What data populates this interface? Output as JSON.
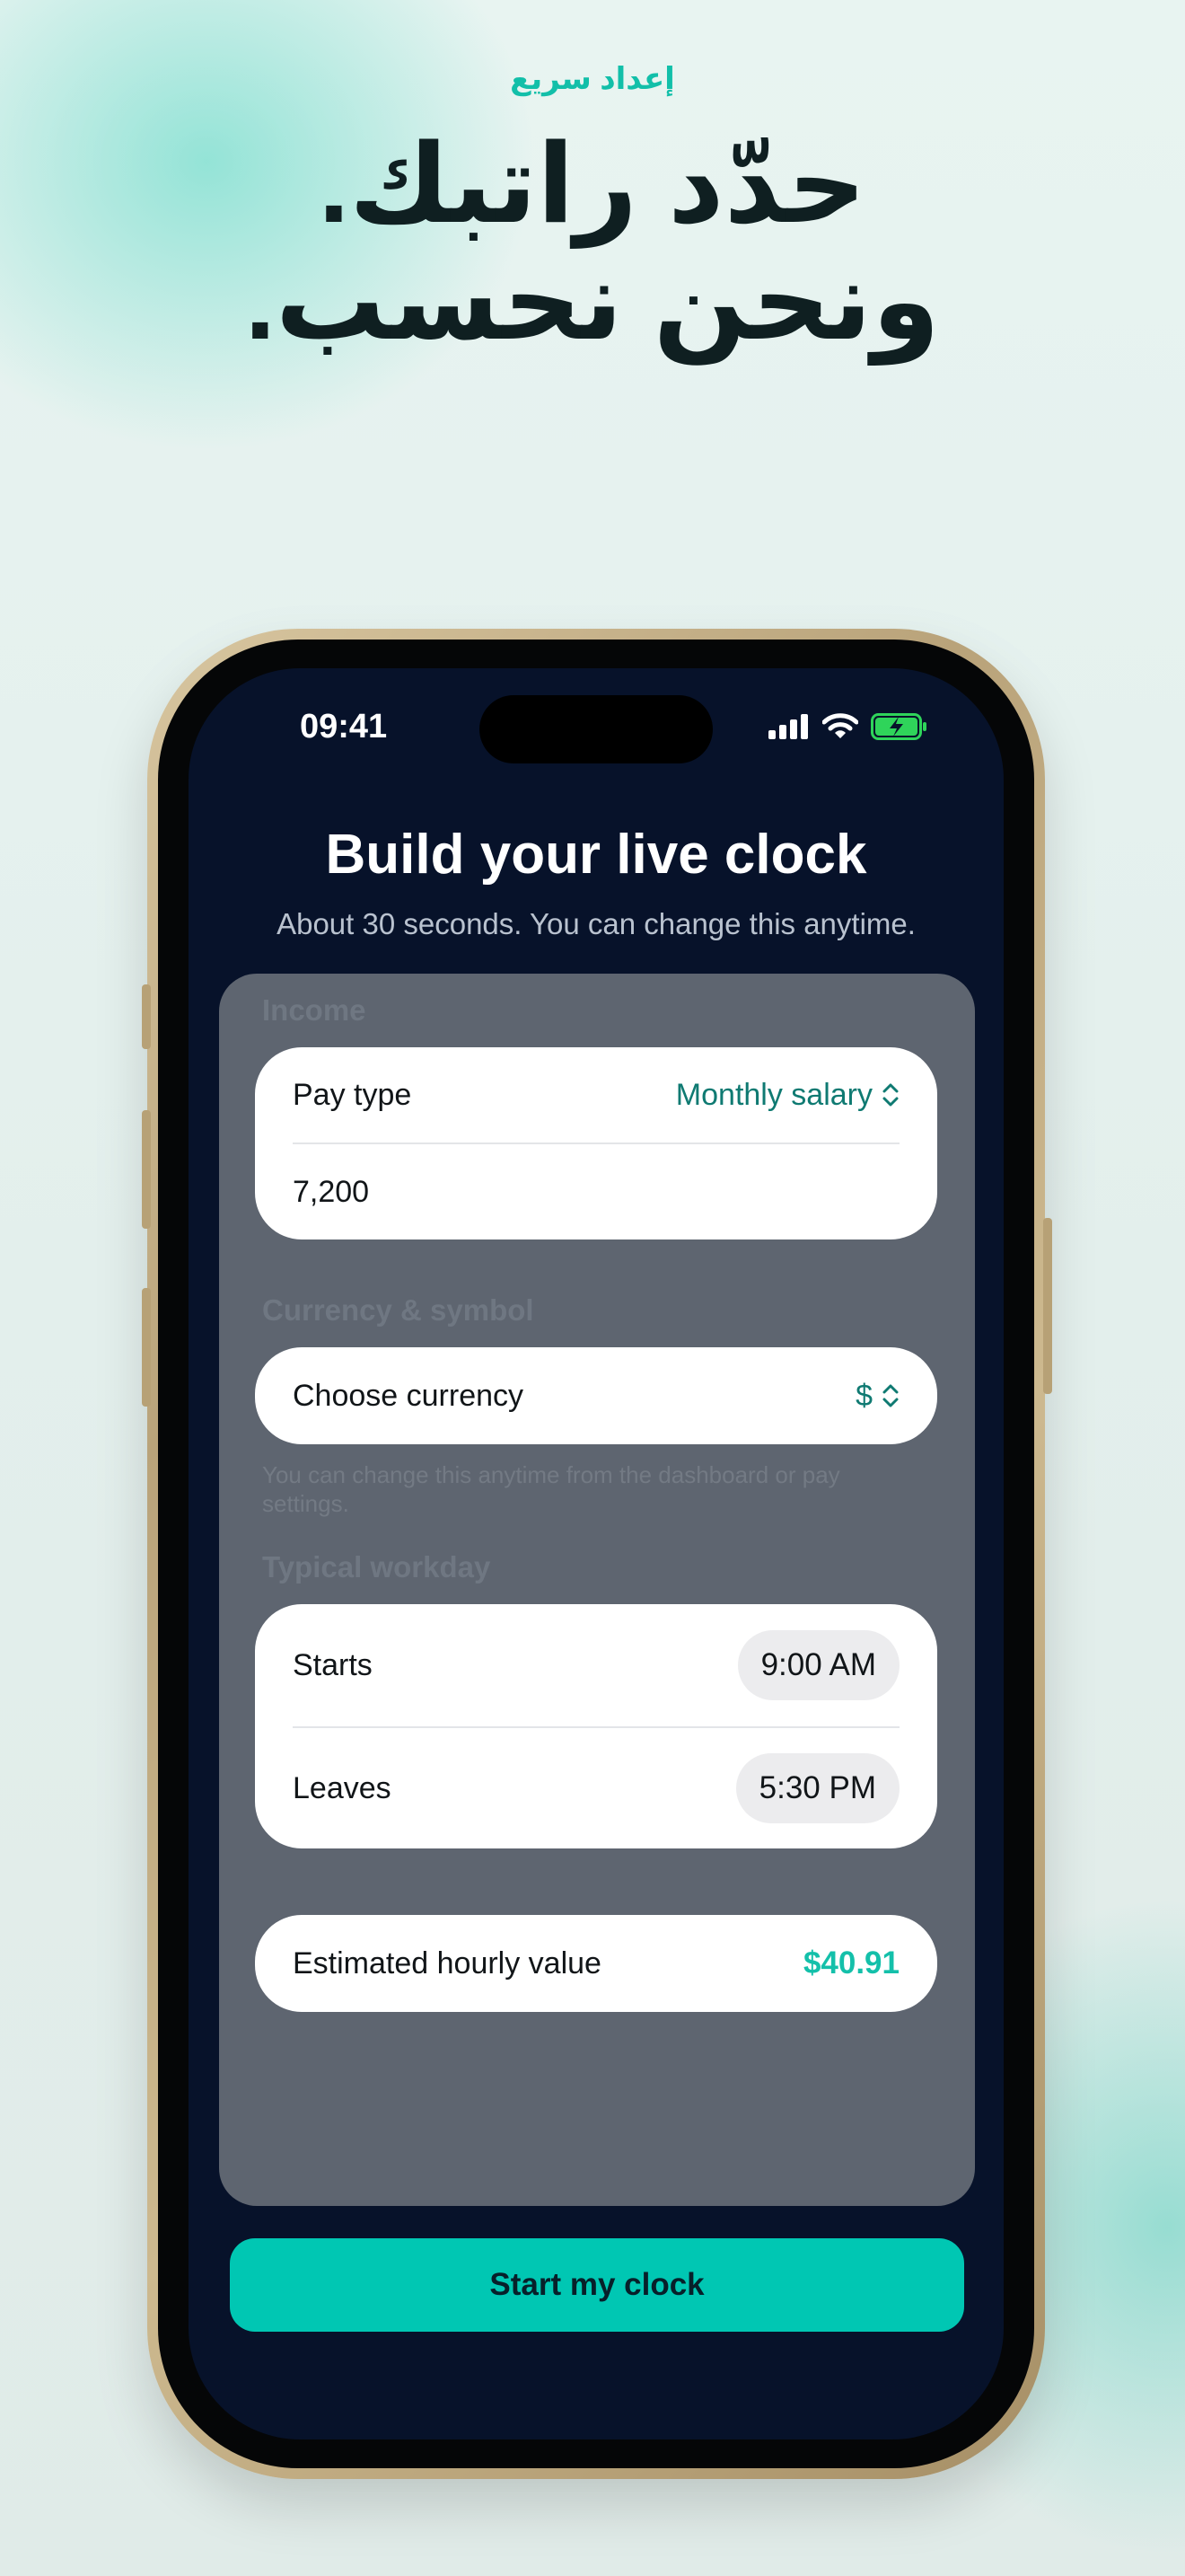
{
  "hero": {
    "eyebrow": "إعداد سريع",
    "headline_line1": "حدّد راتبك.",
    "headline_line2": "ونحن نحسب."
  },
  "status_bar": {
    "time": "09:41",
    "icons": [
      "signal-icon",
      "wifi-icon",
      "battery-charging-icon"
    ]
  },
  "screen": {
    "title": "Build your live clock",
    "subtitle": "About 30 seconds. You can change this anytime."
  },
  "income": {
    "section_label": "Income",
    "pay_type_label": "Pay type",
    "pay_type_value": "Monthly salary",
    "amount_value": "7,200"
  },
  "currency": {
    "section_label": "Currency & symbol",
    "choose_label": "Choose currency",
    "symbol": "$",
    "help": "You can change this anytime from the dashboard or pay settings."
  },
  "workday": {
    "section_label": "Typical workday",
    "starts_label": "Starts",
    "starts_value": "9:00 AM",
    "leaves_label": "Leaves",
    "leaves_value": "5:30 PM"
  },
  "estimate": {
    "label": "Estimated hourly value",
    "value": "$40.91"
  },
  "cta": {
    "label": "Start my clock"
  },
  "colors": {
    "accent": "#00c7b3",
    "screen_bg": "#07122a",
    "value_teal": "#0f7a72"
  }
}
